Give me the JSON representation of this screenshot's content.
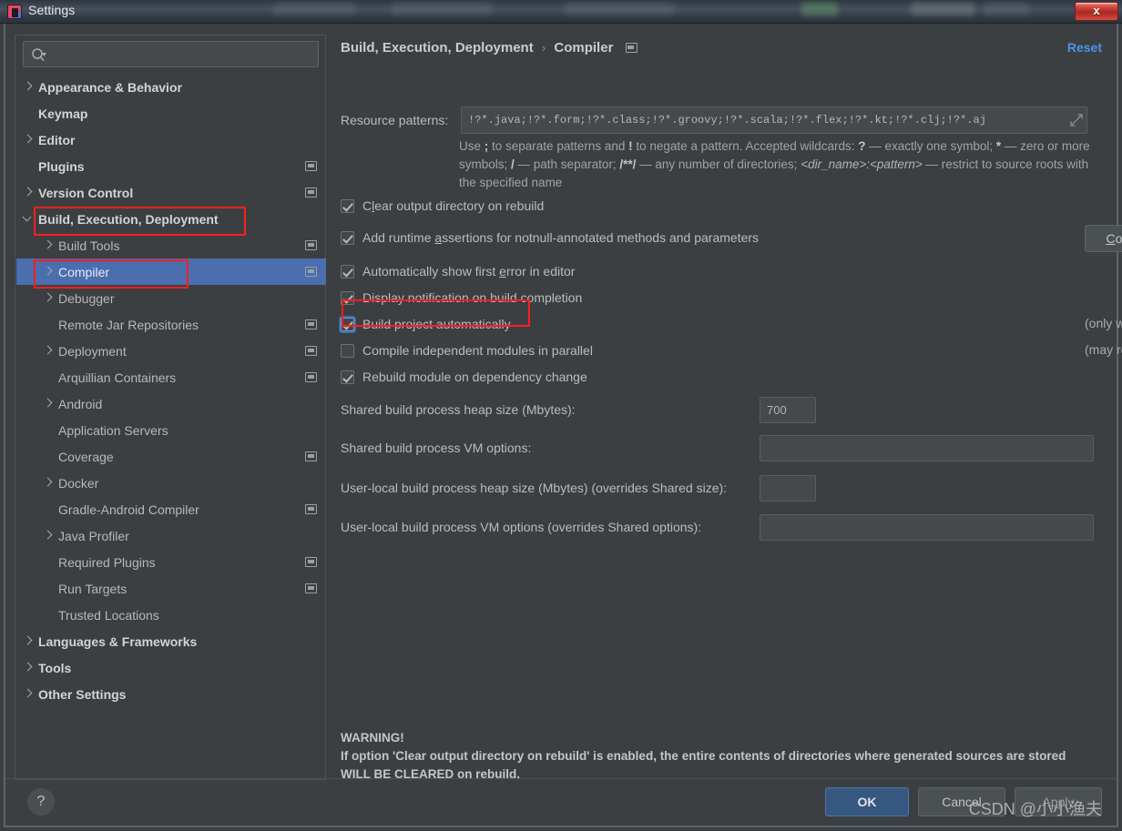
{
  "window": {
    "title": "Settings",
    "app_icon": "intellij-logo-icon",
    "close_label": "x"
  },
  "sidebar": {
    "search": {
      "placeholder": "",
      "value": "",
      "icon": "search-icon"
    },
    "items": [
      {
        "label": "Appearance & Behavior",
        "level": 0,
        "arrow": "right",
        "badge": false,
        "selected": false
      },
      {
        "label": "Keymap",
        "level": 0,
        "arrow": "none",
        "badge": false,
        "selected": false
      },
      {
        "label": "Editor",
        "level": 0,
        "arrow": "right",
        "badge": false,
        "selected": false
      },
      {
        "label": "Plugins",
        "level": 0,
        "arrow": "none",
        "badge": true,
        "selected": false
      },
      {
        "label": "Version Control",
        "level": 0,
        "arrow": "right",
        "badge": true,
        "selected": false
      },
      {
        "label": "Build, Execution, Deployment",
        "level": 0,
        "arrow": "down",
        "badge": false,
        "selected": false
      },
      {
        "label": "Build Tools",
        "level": 1,
        "arrow": "right",
        "badge": true,
        "selected": false
      },
      {
        "label": "Compiler",
        "level": 1,
        "arrow": "right",
        "badge": true,
        "selected": true
      },
      {
        "label": "Debugger",
        "level": 1,
        "arrow": "right",
        "badge": false,
        "selected": false
      },
      {
        "label": "Remote Jar Repositories",
        "level": 1,
        "arrow": "none",
        "badge": true,
        "selected": false
      },
      {
        "label": "Deployment",
        "level": 1,
        "arrow": "right",
        "badge": true,
        "selected": false
      },
      {
        "label": "Arquillian Containers",
        "level": 1,
        "arrow": "none",
        "badge": true,
        "selected": false
      },
      {
        "label": "Android",
        "level": 1,
        "arrow": "right",
        "badge": false,
        "selected": false
      },
      {
        "label": "Application Servers",
        "level": 1,
        "arrow": "none",
        "badge": false,
        "selected": false
      },
      {
        "label": "Coverage",
        "level": 1,
        "arrow": "none",
        "badge": true,
        "selected": false
      },
      {
        "label": "Docker",
        "level": 1,
        "arrow": "right",
        "badge": false,
        "selected": false
      },
      {
        "label": "Gradle-Android Compiler",
        "level": 1,
        "arrow": "none",
        "badge": true,
        "selected": false
      },
      {
        "label": "Java Profiler",
        "level": 1,
        "arrow": "right",
        "badge": false,
        "selected": false
      },
      {
        "label": "Required Plugins",
        "level": 1,
        "arrow": "none",
        "badge": true,
        "selected": false
      },
      {
        "label": "Run Targets",
        "level": 1,
        "arrow": "none",
        "badge": true,
        "selected": false
      },
      {
        "label": "Trusted Locations",
        "level": 1,
        "arrow": "none",
        "badge": false,
        "selected": false
      },
      {
        "label": "Languages & Frameworks",
        "level": 0,
        "arrow": "right",
        "badge": false,
        "selected": false
      },
      {
        "label": "Tools",
        "level": 0,
        "arrow": "right",
        "badge": false,
        "selected": false
      },
      {
        "label": "Other Settings",
        "level": 0,
        "arrow": "right",
        "badge": false,
        "selected": false
      }
    ]
  },
  "main": {
    "breadcrumb": {
      "root": "Build, Execution, Deployment",
      "separator": "›",
      "leaf": "Compiler"
    },
    "reset_label": "Reset",
    "resource_patterns": {
      "label": "Resource patterns:",
      "value": "!?*.java;!?*.form;!?*.class;!?*.groovy;!?*.scala;!?*.flex;!?*.kt;!?*.clj;!?*.aj"
    },
    "help_text": {
      "line1_a": "Use ",
      "b1": ";",
      "line1_b": " to separate patterns and ",
      "b2": "!",
      "line1_c": " to negate a pattern. Accepted wildcards: ",
      "b3": "?",
      "line1_d": " — exactly one symbol; ",
      "b4": "*",
      "line1_e": " — zero or more symbols; ",
      "b5": "/",
      "line1_f": " — path separator; ",
      "b6": "/**/",
      "line1_g": " — any number of directories; ",
      "i1": "<dir_name>:<pattern>",
      "line1_h": " — restrict to source roots with the specified name"
    },
    "checkboxes": [
      {
        "label_pre": "C",
        "label_mn": "l",
        "label_post": "ear output directory on rebuild",
        "checked": true,
        "focused": false
      },
      {
        "label_pre": "Add runtime ",
        "label_mn": "a",
        "label_post": "ssertions for notnull-annotated methods and parameters",
        "checked": true,
        "focused": false
      },
      {
        "label_pre": "Automatically show first ",
        "label_mn": "e",
        "label_post": "rror in editor",
        "checked": true,
        "focused": false
      },
      {
        "label_pre": "Display notification on build completion",
        "label_mn": "",
        "label_post": "",
        "checked": true,
        "focused": false
      },
      {
        "label_pre": "Build project automatically",
        "label_mn": "",
        "label_post": "",
        "checked": true,
        "focused": true
      },
      {
        "label_pre": "Compile independent modules in parallel",
        "label_mn": "",
        "label_post": "",
        "checked": false,
        "focused": false
      },
      {
        "label_pre": "Rebuild module on dependency change",
        "label_mn": "",
        "label_post": "",
        "checked": true,
        "focused": false
      }
    ],
    "configure_annotations": {
      "pre": "C",
      "mn": "",
      "label": "Configure annotations…"
    },
    "hints": {
      "build_auto": "(only works while not running / debugging)",
      "parallel": "(may require larger heap size)"
    },
    "fields": [
      {
        "label": "Shared build process heap size (Mbytes):",
        "value": "700",
        "wide": false
      },
      {
        "label": "Shared build process VM options:",
        "value": "",
        "wide": true
      },
      {
        "label": "User-local build process heap size (Mbytes) (overrides Shared size):",
        "value": "",
        "wide": false
      },
      {
        "label": "User-local build process VM options (overrides Shared options):",
        "value": "",
        "wide": true
      }
    ],
    "warning": {
      "title": "WARNING!",
      "body": "If option 'Clear output directory on rebuild' is enabled, the entire contents of directories where generated sources are stored WILL BE CLEARED on rebuild."
    }
  },
  "footer": {
    "help_label": "?",
    "ok_label": "OK",
    "cancel_label": "Cancel",
    "apply_pre": "A",
    "apply_mn": "p",
    "apply_post": "ply",
    "apply_label": "Apply",
    "watermark": "CSDN @小小渔夫"
  },
  "colors": {
    "selection_blue": "#4b6eaf",
    "accent_link": "#4d94e8",
    "annotation_red": "#ff1f1f",
    "ok_button": "#365880",
    "panel_bg": "#3c3f41"
  }
}
